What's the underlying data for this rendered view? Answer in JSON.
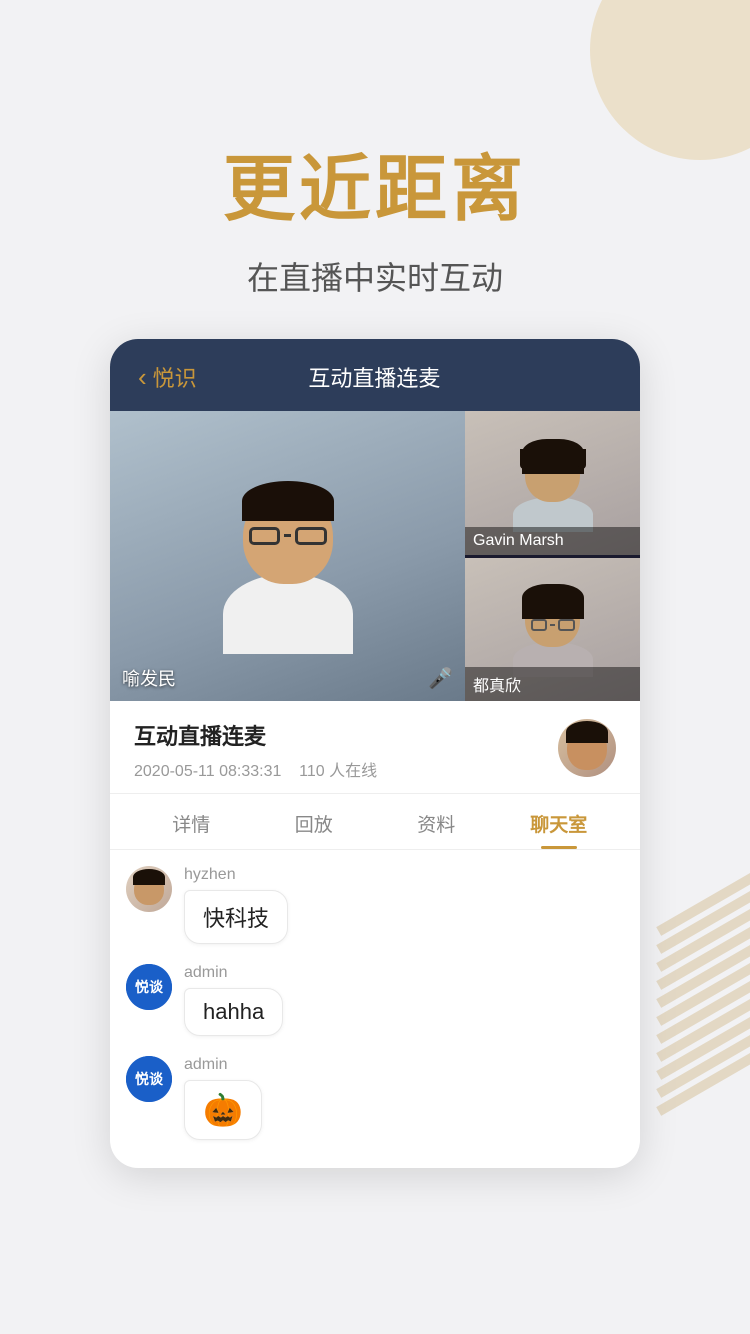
{
  "background": {
    "color": "#f2f2f4"
  },
  "heading": {
    "main_title": "更近距离",
    "sub_title": "在直播中实时互动"
  },
  "phone_card": {
    "header": {
      "back_label": "悦识",
      "title": "互动直播连麦"
    },
    "video_grid": {
      "main_person": {
        "name": "喻发民"
      },
      "side_top": {
        "name": "Gavin Marsh"
      },
      "side_bottom": {
        "name": "都真欣"
      }
    },
    "info": {
      "title": "互动直播连麦",
      "date": "2020-05-11 08:33:31",
      "online": "110 人在线"
    },
    "tabs": [
      {
        "label": "详情",
        "active": false
      },
      {
        "label": "回放",
        "active": false
      },
      {
        "label": "资料",
        "active": false
      },
      {
        "label": "聊天室",
        "active": true
      }
    ],
    "chat": {
      "messages": [
        {
          "avatar_type": "photo",
          "username": "hyzhen",
          "message": "快科技"
        },
        {
          "avatar_type": "logo",
          "username": "admin",
          "message": "hahha"
        },
        {
          "avatar_type": "logo",
          "username": "admin",
          "message": "🎃"
        }
      ]
    }
  }
}
